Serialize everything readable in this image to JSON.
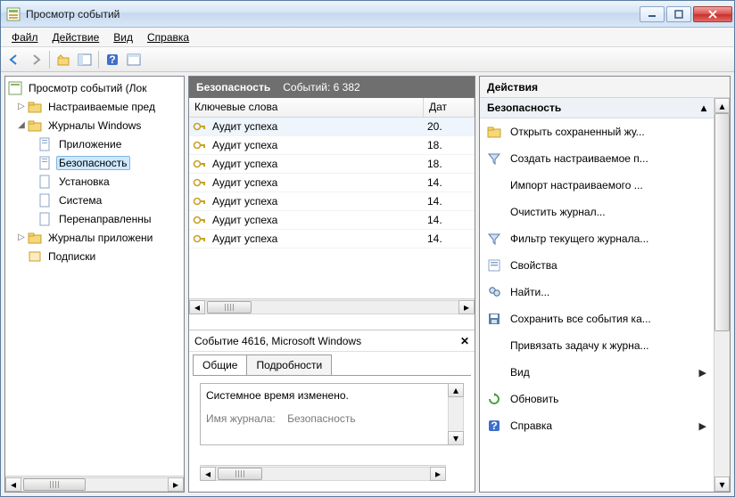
{
  "window": {
    "title": "Просмотр событий"
  },
  "menubar": [
    "Файл",
    "Действие",
    "Вид",
    "Справка"
  ],
  "tree": {
    "root": "Просмотр событий (Лок",
    "customViews": "Настраиваемые пред",
    "winLogs": "Журналы Windows",
    "items": [
      "Приложение",
      "Безопасность",
      "Установка",
      "Система",
      "Перенаправленны"
    ],
    "appLogs": "Журналы приложени",
    "subs": "Подписки"
  },
  "center": {
    "headerName": "Безопасность",
    "headerCount": "Событий: 6 382",
    "cols": {
      "keywords": "Ключевые слова",
      "date": "Дат"
    },
    "rows": [
      {
        "kw": "Аудит успеха",
        "dt": "20."
      },
      {
        "kw": "Аудит успеха",
        "dt": "18."
      },
      {
        "kw": "Аудит успеха",
        "dt": "18."
      },
      {
        "kw": "Аудит успеха",
        "dt": "14."
      },
      {
        "kw": "Аудит успеха",
        "dt": "14."
      },
      {
        "kw": "Аудит успеха",
        "dt": "14."
      },
      {
        "kw": "Аудит успеха",
        "dt": "14."
      }
    ],
    "detailTitle": "Событие 4616, Microsoft Windows",
    "tabs": {
      "general": "Общие",
      "details": "Подробности"
    },
    "detailMsg": "Системное время изменено.",
    "detailSub1": "Имя журнала:",
    "detailSub2": "Безопасность"
  },
  "actions": {
    "title": "Действия",
    "group": "Безопасность",
    "items": [
      {
        "icon": "folder",
        "label": "Открыть сохраненный жу..."
      },
      {
        "icon": "funnel",
        "label": "Создать настраиваемое п..."
      },
      {
        "icon": "none",
        "label": "Импорт настраиваемого ..."
      },
      {
        "icon": "none",
        "label": "Очистить журнал..."
      },
      {
        "icon": "funnel",
        "label": "Фильтр текущего журнала..."
      },
      {
        "icon": "props",
        "label": "Свойства"
      },
      {
        "icon": "find",
        "label": "Найти..."
      },
      {
        "icon": "save",
        "label": "Сохранить все события ка..."
      },
      {
        "icon": "none",
        "label": "Привязать задачу к журна..."
      },
      {
        "icon": "none",
        "label": "Вид",
        "submenu": true
      },
      {
        "icon": "refresh",
        "label": "Обновить"
      },
      {
        "icon": "help",
        "label": "Справка",
        "submenu": true
      }
    ]
  }
}
